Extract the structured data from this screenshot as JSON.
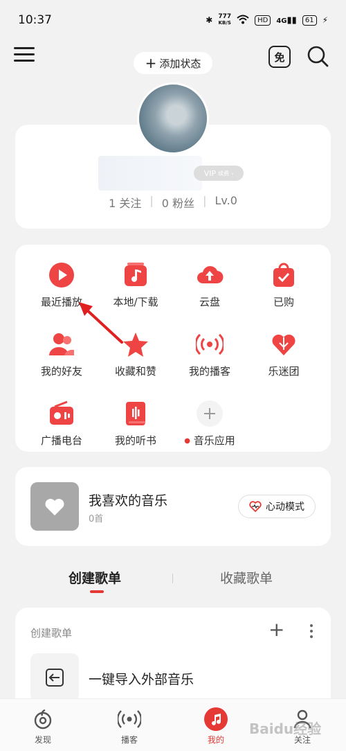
{
  "status_bar": {
    "time": "10:37",
    "speed_value": "777",
    "speed_unit": "KB/S",
    "hd": "HD",
    "network": "4G",
    "battery": "61"
  },
  "topbar": {
    "add_status_label": "添加状态",
    "free_label": "免"
  },
  "profile": {
    "vip_badge": "VIP",
    "vip_renew": "续费",
    "stats": {
      "following": "1 关注",
      "fans": "0 粉丝",
      "level": "Lv.0"
    }
  },
  "grid": [
    {
      "label": "最近播放",
      "icon": "play-circle-icon"
    },
    {
      "label": "本地/下载",
      "icon": "music-note-icon"
    },
    {
      "label": "云盘",
      "icon": "cloud-upload-icon"
    },
    {
      "label": "已购",
      "icon": "shopping-bag-icon"
    },
    {
      "label": "我的好友",
      "icon": "friends-icon"
    },
    {
      "label": "收藏和赞",
      "icon": "star-icon"
    },
    {
      "label": "我的播客",
      "icon": "podcast-icon"
    },
    {
      "label": "乐迷团",
      "icon": "fan-club-heart-icon"
    },
    {
      "label": "广播电台",
      "icon": "radio-icon"
    },
    {
      "label": "我的听书",
      "icon": "audiobook-icon"
    },
    {
      "label": "音乐应用",
      "icon": "add-icon"
    }
  ],
  "favorites": {
    "title": "我喜欢的音乐",
    "count": "0首",
    "heartbeat_mode": "心动模式"
  },
  "tabs": {
    "created": "创建歌单",
    "collected": "收藏歌单"
  },
  "playlist": {
    "header": "创建歌单",
    "import_label": "一键导入外部音乐"
  },
  "bottom_nav": [
    {
      "label": "发现",
      "icon": "discover-icon"
    },
    {
      "label": "播客",
      "icon": "podcast-icon"
    },
    {
      "label": "我的",
      "icon": "music-note-icon"
    },
    {
      "label": "关注",
      "icon": "follow-icon"
    }
  ],
  "watermark": "Baidu经验",
  "colors": {
    "accent": "#e53935",
    "background": "#f2f2f2"
  }
}
